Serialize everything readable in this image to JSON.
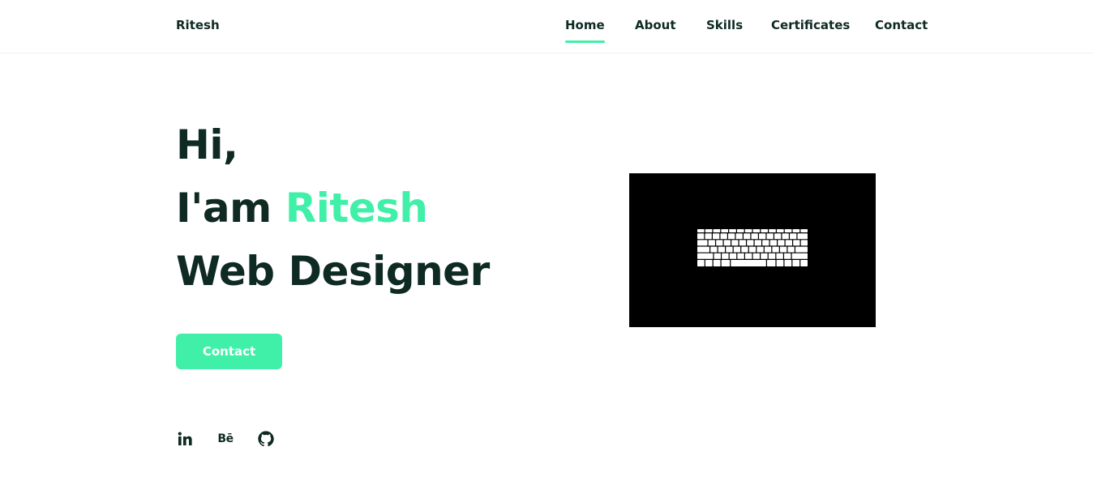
{
  "header": {
    "logo": "Ritesh",
    "nav": [
      {
        "label": "Home",
        "active": true
      },
      {
        "label": "About",
        "active": false
      },
      {
        "label": "Skills",
        "active": false
      },
      {
        "label": "Certificates",
        "active": false
      },
      {
        "label": "Contact",
        "active": false
      }
    ]
  },
  "hero": {
    "greeting": "Hi,",
    "intro_prefix": "I'am",
    "name": "Ritesh",
    "role": "Web Designer",
    "button_label": "Contact",
    "image_icon": "keyboard-image"
  },
  "social": {
    "linkedin_icon": "linkedin-icon",
    "behance_label": "Bē",
    "behance_icon": "behance-icon",
    "github_icon": "github-icon"
  },
  "colors": {
    "accent": "#41f0a8",
    "text": "#0e2a23",
    "background": "#ffffff",
    "image_background": "#000000"
  }
}
